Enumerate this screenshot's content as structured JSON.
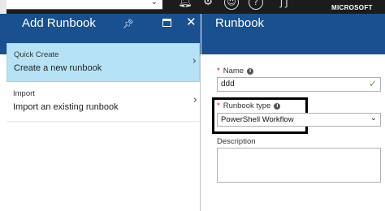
{
  "topbar": {
    "search_chevron": "⌄",
    "brand": "MICROSOFT",
    "icons": [
      "bell-icon",
      "gear-icon",
      "smiley-icon",
      "help-icon",
      "user-icon"
    ]
  },
  "add_runbook_blade": {
    "title": "Add Runbook",
    "items": [
      {
        "small": "Quick Create",
        "big": "Create a new runbook",
        "selected": true
      },
      {
        "small": "Import",
        "big": "Import an existing runbook",
        "selected": false
      }
    ]
  },
  "runbook_blade": {
    "title": "Runbook",
    "name_label": "Name",
    "name_value": "ddd",
    "type_label": "Runbook type",
    "type_value": "PowerShell Workflow",
    "description_label": "Description",
    "description_value": ""
  },
  "colors": {
    "header": "#19508f",
    "selected_item": "#b5e3f5",
    "required": "#cc0000",
    "valid": "#5aa02c"
  }
}
